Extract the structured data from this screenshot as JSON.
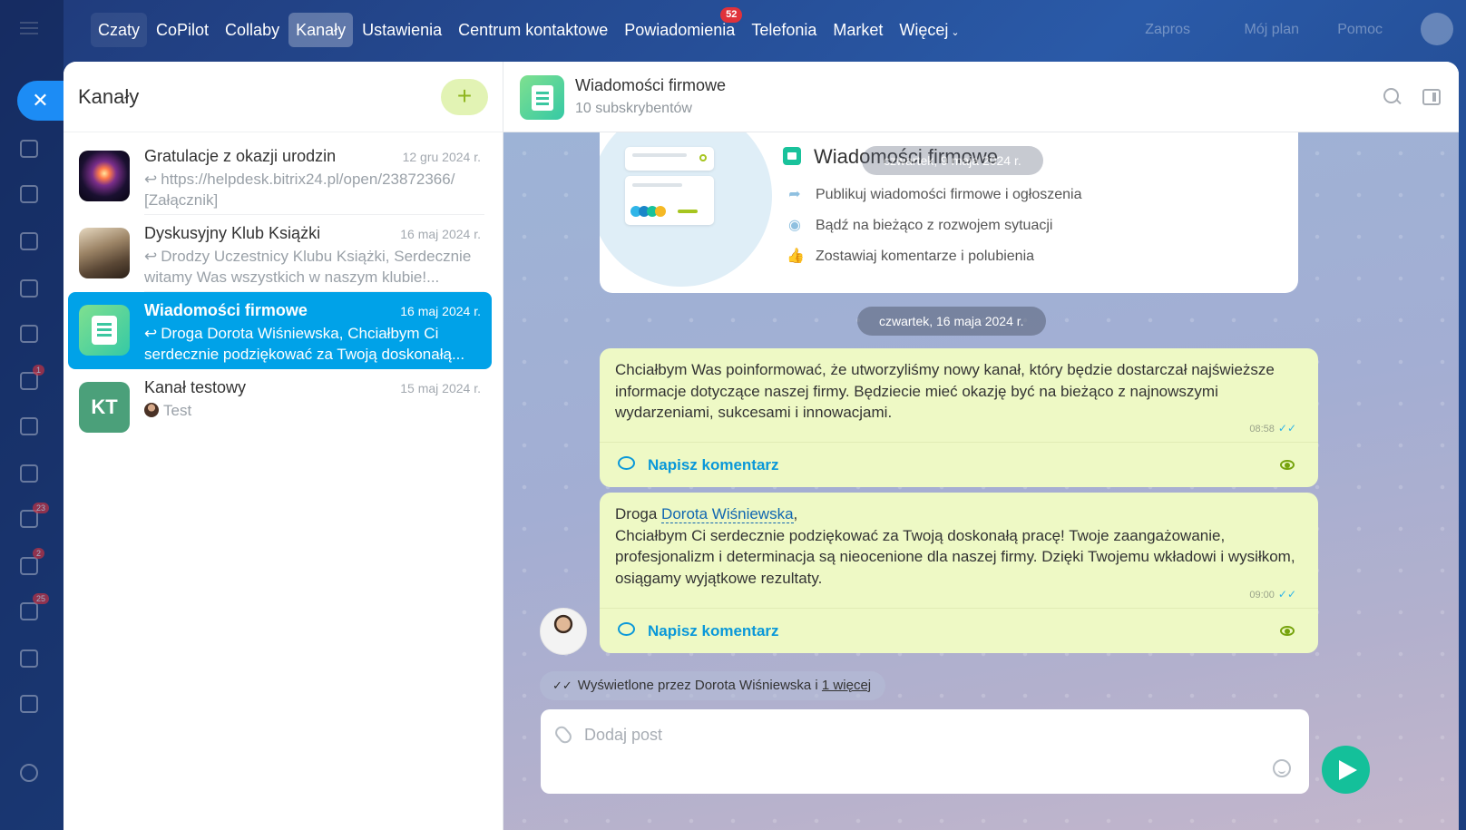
{
  "topnav": {
    "tabs": [
      {
        "label": "Czaty"
      },
      {
        "label": "CoPilot"
      },
      {
        "label": "Collaby"
      },
      {
        "label": "Kanały"
      },
      {
        "label": "Ustawienia"
      },
      {
        "label": "Centrum kontaktowe"
      },
      {
        "label": "Powiadomienia",
        "badge": "52"
      },
      {
        "label": "Telefonia"
      },
      {
        "label": "Market"
      },
      {
        "label": "Więcej"
      }
    ],
    "active_tab": "Kanały"
  },
  "background": {
    "right_items": [
      "Zapros",
      "Mój plan",
      "Pomoc"
    ],
    "left_badges": [
      "1",
      "23",
      "2",
      "25"
    ]
  },
  "sidebar": {
    "title": "Kanały",
    "add_label": "+",
    "chats": [
      {
        "name": "Gratulacje z okazji urodzin",
        "date": "12 gru 2024 r.",
        "preview": "https://helpdesk.bitrix24.pl/open/23872366/ [Załącznik]",
        "prefix": "↩"
      },
      {
        "name": "Dyskusyjny Klub Książki",
        "date": "16 maj 2024 r.",
        "preview": "Drodzy Uczestnicy Klubu Książki, Serdecznie witamy Was wszystkich w naszym klubie!...",
        "prefix": "↩"
      },
      {
        "name": "Wiadomości firmowe",
        "date": "16 maj 2024 r.",
        "preview": "Droga Dorota Wiśniewska, Chciałbym Ci serdecznie podziękować za Twoją doskonałą...",
        "prefix": "↩",
        "active": true
      },
      {
        "name": "Kanał testowy",
        "date": "15 maj 2024 r.",
        "preview": "Test",
        "avatar_text": "KT"
      }
    ]
  },
  "chat": {
    "title": "Wiadomości firmowe",
    "subtitle": "10 subskrybentów",
    "intro": {
      "title": "Wiadomości firmowe",
      "rows": [
        "Publikuj wiadomości firmowe i ogłoszenia",
        "Bądź na bieżąco z rozwojem sytuacji",
        "Zostawiaj komentarze i polubienia"
      ],
      "overlay_date": "czwartek, 9 maja 2024 r."
    },
    "date_separator": "czwartek, 16 maja 2024 r.",
    "messages": [
      {
        "text": "Chciałbym Was poinformować, że utworzyliśmy nowy kanał, który będzie dostarczał najświeższe informacje dotyczące naszej firmy. Będziecie mieć okazję być na bieżąco z najnowszymi wydarzeniami, sukcesami i innowacjami.",
        "time": "08:58",
        "comment_label": "Napisz komentarz"
      },
      {
        "greeting": "Droga",
        "mention": "Dorota Wiśniewska",
        "greeting_end": ",",
        "text": "Chciałbym Ci serdecznie podziękować za Twoją doskonałą pracę! Twoje zaangażowanie, profesjonalizm i determinacja są nieocenione dla naszej firmy. Dzięki Twojemu wkładowi i wysiłkom, osiągamy wyjątkowe rezultaty.",
        "time": "09:00",
        "comment_label": "Napisz komentarz"
      }
    ],
    "seen_by": "Wyświetlone przez Dorota Wiśniewska i",
    "seen_more": "1 więcej",
    "composer_placeholder": "Dodaj post"
  },
  "colors": {
    "accent": "#00a2e8",
    "message_bg": "#eef9c5",
    "send": "#14c09a"
  }
}
